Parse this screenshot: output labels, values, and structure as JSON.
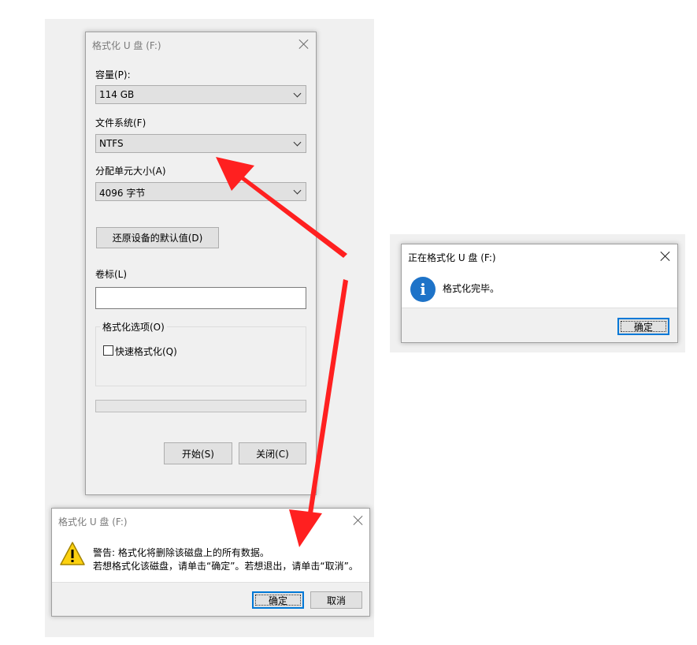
{
  "format_dialog": {
    "title": "格式化 U 盘 (F:)",
    "capacity_label": "容量(P):",
    "capacity_value": "114 GB",
    "filesystem_label": "文件系统(F)",
    "filesystem_value": "NTFS",
    "alloc_label": "分配单元大小(A)",
    "alloc_value": "4096 字节",
    "restore_defaults_label": "还原设备的默认值(D)",
    "volume_label": "卷标(L)",
    "volume_value": "",
    "format_options_label": "格式化选项(O)",
    "quick_format_label": "快速格式化(Q)",
    "quick_format_checked": false,
    "progress": 0,
    "start_label": "开始(S)",
    "close_label": "关闭(C)"
  },
  "complete_dialog": {
    "title": "正在格式化 U 盘 (F:)",
    "message": "格式化完毕。",
    "ok_label": "确定",
    "icon": "info-icon"
  },
  "warning_dialog": {
    "title": "格式化 U 盘 (F:)",
    "message_line1": "警告: 格式化将删除该磁盘上的所有数据。",
    "message_line2": "若想格式化该磁盘，请单击“确定”。若想退出，请单击“取消”。",
    "ok_label": "确定",
    "cancel_label": "取消",
    "icon": "warning-icon"
  },
  "annotations": {
    "arrow_color": "#ff2020"
  }
}
